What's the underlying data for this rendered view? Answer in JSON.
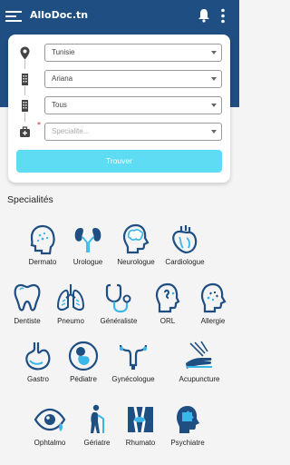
{
  "app": {
    "title": "AlloDoc.tn"
  },
  "search": {
    "country": "Tunisie",
    "city": "Ariana",
    "area": "Tous",
    "specialite_placeholder": "Specialite...",
    "button_label": "Trouver"
  },
  "section_title": "Specialités",
  "specialties": [
    "Dermato",
    "Urologue",
    "Neurologue",
    "Cardiologue",
    "Dentiste",
    "Pneumo",
    "Généraliste",
    "ORL",
    "Allergie",
    "Gastro",
    "Pédiatre",
    "Gynécologue",
    "Acupuncture",
    "Ophtalmo",
    "Gériatre",
    "Rhumato",
    "Psychiatre"
  ],
  "colors": {
    "header": "#1f4e82",
    "accent": "#5ddcf3",
    "icon_dark": "#1f4e82",
    "icon_light": "#3ab6e8"
  }
}
